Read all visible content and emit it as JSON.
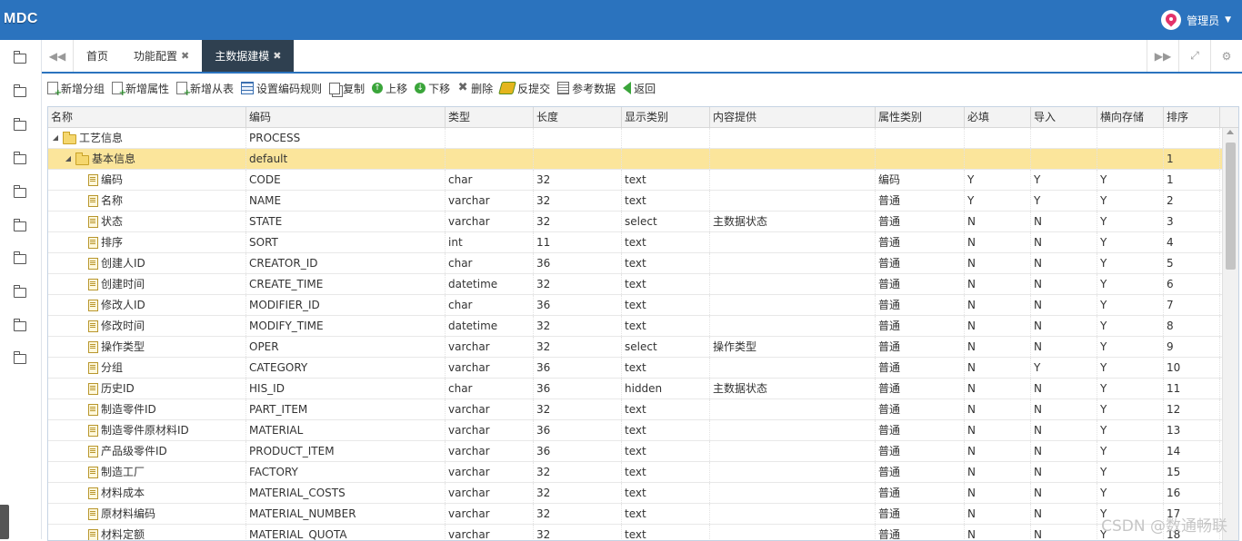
{
  "header": {
    "logo": "MDC",
    "user": "管理员"
  },
  "tabs": {
    "prev_icon": "double-left-icon",
    "items": [
      {
        "label": "首页",
        "closable": false,
        "active": false
      },
      {
        "label": "功能配置",
        "closable": true,
        "active": false
      },
      {
        "label": "主数据建模",
        "closable": true,
        "active": true
      }
    ],
    "next_icon": "double-right-icon",
    "fullscreen_icon": "expand-icon",
    "settings_icon": "gear-icon"
  },
  "toolbar": {
    "add_group": "新增分组",
    "add_attr": "新增属性",
    "add_sub_table": "新增从表",
    "set_code_rule": "设置编码规则",
    "copy": "复制",
    "move_up": "上移",
    "move_down": "下移",
    "delete": "删除",
    "unsubmit": "反提交",
    "ref_data": "参考数据",
    "back": "返回"
  },
  "grid": {
    "columns": [
      "名称",
      "编码",
      "类型",
      "长度",
      "显示类别",
      "内容提供",
      "属性类别",
      "必填",
      "导入",
      "横向存储",
      "排序"
    ],
    "rows": [
      {
        "level": 0,
        "kind": "folder",
        "name": "工艺信息",
        "code": "PROCESS",
        "type": "",
        "len": "",
        "disp": "",
        "prov": "",
        "cat": "",
        "req": "",
        "imp": "",
        "horiz": "",
        "sort": "",
        "selected": false
      },
      {
        "level": 1,
        "kind": "folder",
        "name": "基本信息",
        "code": "default",
        "type": "",
        "len": "",
        "disp": "",
        "prov": "",
        "cat": "",
        "req": "",
        "imp": "",
        "horiz": "",
        "sort": "1",
        "selected": true
      },
      {
        "level": 2,
        "kind": "leaf",
        "name": "编码",
        "code": "CODE",
        "type": "char",
        "len": "32",
        "disp": "text",
        "prov": "",
        "cat": "编码",
        "req": "Y",
        "imp": "Y",
        "horiz": "Y",
        "sort": "1",
        "selected": false
      },
      {
        "level": 2,
        "kind": "leaf",
        "name": "名称",
        "code": "NAME",
        "type": "varchar",
        "len": "32",
        "disp": "text",
        "prov": "",
        "cat": "普通",
        "req": "Y",
        "imp": "Y",
        "horiz": "Y",
        "sort": "2",
        "selected": false
      },
      {
        "level": 2,
        "kind": "leaf",
        "name": "状态",
        "code": "STATE",
        "type": "varchar",
        "len": "32",
        "disp": "select",
        "prov": "主数据状态",
        "cat": "普通",
        "req": "N",
        "imp": "N",
        "horiz": "Y",
        "sort": "3",
        "selected": false
      },
      {
        "level": 2,
        "kind": "leaf",
        "name": "排序",
        "code": "SORT",
        "type": "int",
        "len": "11",
        "disp": "text",
        "prov": "",
        "cat": "普通",
        "req": "N",
        "imp": "N",
        "horiz": "Y",
        "sort": "4",
        "selected": false
      },
      {
        "level": 2,
        "kind": "leaf",
        "name": "创建人ID",
        "code": "CREATOR_ID",
        "type": "char",
        "len": "36",
        "disp": "text",
        "prov": "",
        "cat": "普通",
        "req": "N",
        "imp": "N",
        "horiz": "Y",
        "sort": "5",
        "selected": false
      },
      {
        "level": 2,
        "kind": "leaf",
        "name": "创建时间",
        "code": "CREATE_TIME",
        "type": "datetime",
        "len": "32",
        "disp": "text",
        "prov": "",
        "cat": "普通",
        "req": "N",
        "imp": "N",
        "horiz": "Y",
        "sort": "6",
        "selected": false
      },
      {
        "level": 2,
        "kind": "leaf",
        "name": "修改人ID",
        "code": "MODIFIER_ID",
        "type": "char",
        "len": "36",
        "disp": "text",
        "prov": "",
        "cat": "普通",
        "req": "N",
        "imp": "N",
        "horiz": "Y",
        "sort": "7",
        "selected": false
      },
      {
        "level": 2,
        "kind": "leaf",
        "name": "修改时间",
        "code": "MODIFY_TIME",
        "type": "datetime",
        "len": "32",
        "disp": "text",
        "prov": "",
        "cat": "普通",
        "req": "N",
        "imp": "N",
        "horiz": "Y",
        "sort": "8",
        "selected": false
      },
      {
        "level": 2,
        "kind": "leaf",
        "name": "操作类型",
        "code": "OPER",
        "type": "varchar",
        "len": "32",
        "disp": "select",
        "prov": "操作类型",
        "cat": "普通",
        "req": "N",
        "imp": "N",
        "horiz": "Y",
        "sort": "9",
        "selected": false
      },
      {
        "level": 2,
        "kind": "leaf",
        "name": "分组",
        "code": "CATEGORY",
        "type": "varchar",
        "len": "36",
        "disp": "text",
        "prov": "",
        "cat": "普通",
        "req": "N",
        "imp": "Y",
        "horiz": "Y",
        "sort": "10",
        "selected": false
      },
      {
        "level": 2,
        "kind": "leaf",
        "name": "历史ID",
        "code": "HIS_ID",
        "type": "char",
        "len": "36",
        "disp": "hidden",
        "prov": "主数据状态",
        "cat": "普通",
        "req": "N",
        "imp": "N",
        "horiz": "Y",
        "sort": "11",
        "selected": false
      },
      {
        "level": 2,
        "kind": "leaf",
        "name": "制造零件ID",
        "code": "PART_ITEM",
        "type": "varchar",
        "len": "32",
        "disp": "text",
        "prov": "",
        "cat": "普通",
        "req": "N",
        "imp": "N",
        "horiz": "Y",
        "sort": "12",
        "selected": false
      },
      {
        "level": 2,
        "kind": "leaf",
        "name": "制造零件原材料ID",
        "code": "MATERIAL",
        "type": "varchar",
        "len": "36",
        "disp": "text",
        "prov": "",
        "cat": "普通",
        "req": "N",
        "imp": "N",
        "horiz": "Y",
        "sort": "13",
        "selected": false
      },
      {
        "level": 2,
        "kind": "leaf",
        "name": "产品级零件ID",
        "code": "PRODUCT_ITEM",
        "type": "varchar",
        "len": "36",
        "disp": "text",
        "prov": "",
        "cat": "普通",
        "req": "N",
        "imp": "N",
        "horiz": "Y",
        "sort": "14",
        "selected": false
      },
      {
        "level": 2,
        "kind": "leaf",
        "name": "制造工厂",
        "code": "FACTORY",
        "type": "varchar",
        "len": "32",
        "disp": "text",
        "prov": "",
        "cat": "普通",
        "req": "N",
        "imp": "N",
        "horiz": "Y",
        "sort": "15",
        "selected": false
      },
      {
        "level": 2,
        "kind": "leaf",
        "name": "材料成本",
        "code": "MATERIAL_COSTS",
        "type": "varchar",
        "len": "32",
        "disp": "text",
        "prov": "",
        "cat": "普通",
        "req": "N",
        "imp": "N",
        "horiz": "Y",
        "sort": "16",
        "selected": false
      },
      {
        "level": 2,
        "kind": "leaf",
        "name": "原材料编码",
        "code": "MATERIAL_NUMBER",
        "type": "varchar",
        "len": "32",
        "disp": "text",
        "prov": "",
        "cat": "普通",
        "req": "N",
        "imp": "N",
        "horiz": "Y",
        "sort": "17",
        "selected": false
      },
      {
        "level": 2,
        "kind": "leaf",
        "name": "材料定额",
        "code": "MATERIAL_QUOTA",
        "type": "varchar",
        "len": "32",
        "disp": "text",
        "prov": "",
        "cat": "普通",
        "req": "N",
        "imp": "N",
        "horiz": "Y",
        "sort": "18",
        "selected": false
      }
    ]
  },
  "watermark": "CSDN @数通畅联",
  "colors": {
    "header_bg": "#2b73be",
    "active_tab_bg": "#2f4050",
    "selected_row": "#fbe59b"
  }
}
